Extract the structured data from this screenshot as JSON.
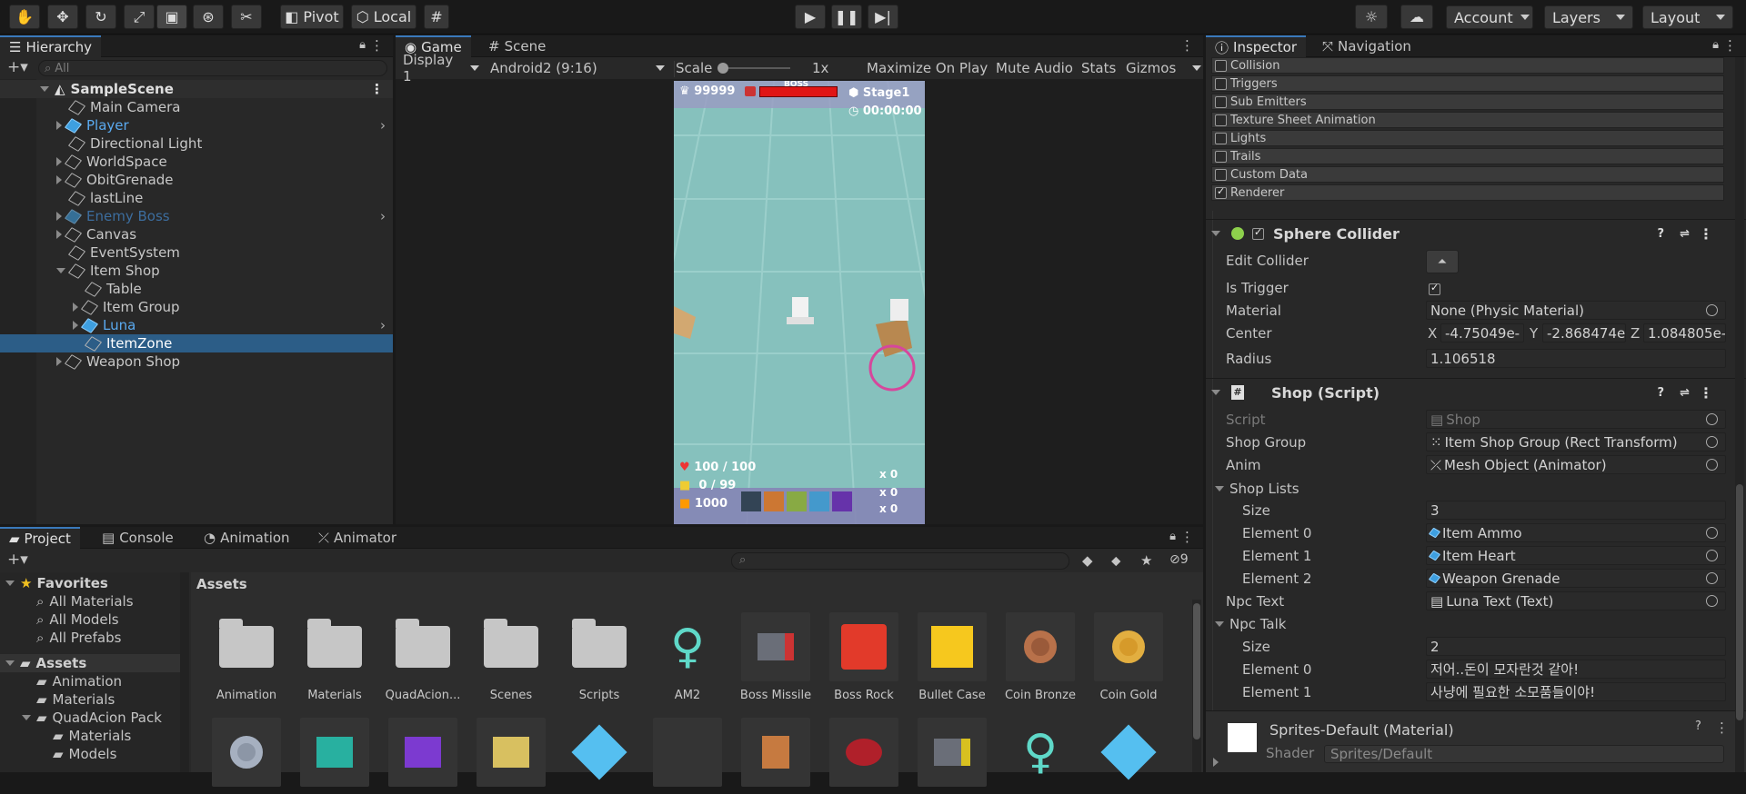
{
  "toolbar": {
    "pivot": "Pivot",
    "local": "Local",
    "account": "Account",
    "layers": "Layers",
    "layout": "Layout"
  },
  "hierarchy": {
    "tab": "Hierarchy",
    "search_placeholder": "All",
    "scene": "SampleScene",
    "items": [
      {
        "label": "Main Camera"
      },
      {
        "label": "Player"
      },
      {
        "label": "Directional Light"
      },
      {
        "label": "WorldSpace"
      },
      {
        "label": "ObitGrenade"
      },
      {
        "label": "lastLine"
      },
      {
        "label": "Enemy Boss"
      },
      {
        "label": "Canvas"
      },
      {
        "label": "EventSystem"
      },
      {
        "label": "Item Shop"
      },
      {
        "label": "Table"
      },
      {
        "label": "Item Group"
      },
      {
        "label": "Luna"
      },
      {
        "label": "ItemZone"
      },
      {
        "label": "Weapon Shop"
      }
    ]
  },
  "game": {
    "tab_game": "Game",
    "tab_scene": "Scene",
    "display": "Display 1",
    "aspect": "Android2 (9:16)",
    "scale_label": "Scale",
    "scale_value": "1x",
    "maximize": "Maximize On Play",
    "mute": "Mute Audio",
    "stats": "Stats",
    "gizmos": "Gizmos",
    "hud": {
      "score": "99999",
      "boss": "BOSS",
      "stage": "Stage1",
      "time": "00:00:00",
      "hp": "100 / 100",
      "bag": "0 / 99",
      "coins": "1000",
      "c1": "x 0",
      "c2": "x 0",
      "c3": "x 0"
    }
  },
  "project": {
    "tabs": {
      "project": "Project",
      "console": "Console",
      "animation": "Animation",
      "animator": "Animator"
    },
    "count": "9",
    "favorites": "Favorites",
    "fav_items": [
      "All Materials",
      "All Models",
      "All Prefabs"
    ],
    "assets_root": "Assets",
    "tree": [
      "Animation",
      "Materials",
      "QuadAcion Pack",
      "Materials",
      "Models"
    ],
    "breadcrumb": "Assets",
    "assets": [
      "Animation",
      "Materials",
      "QuadAcion...",
      "Scenes",
      "Scripts",
      "AM2",
      "Boss Missile",
      "Boss Rock",
      "Bullet Case",
      "Coin Bronze",
      "Coin Gold"
    ]
  },
  "inspector": {
    "tab": "Inspector",
    "tab2": "Navigation",
    "modules": [
      {
        "label": "Collision",
        "checked": false
      },
      {
        "label": "Triggers",
        "checked": false
      },
      {
        "label": "Sub Emitters",
        "checked": false
      },
      {
        "label": "Texture Sheet Animation",
        "checked": false
      },
      {
        "label": "Lights",
        "checked": false
      },
      {
        "label": "Trails",
        "checked": false
      },
      {
        "label": "Custom Data",
        "checked": false
      },
      {
        "label": "Renderer",
        "checked": true
      }
    ],
    "sphere": {
      "title": "Sphere Collider",
      "edit": "Edit Collider",
      "is_trigger": "Is Trigger",
      "material": "Material",
      "material_val": "None (Physic Material)",
      "center": "Center",
      "cx": "-4.75049e-",
      "cy": "-2.868474e",
      "cz": "1.084805e-",
      "radius": "Radius",
      "radius_val": "1.106518"
    },
    "shop": {
      "title": "Shop (Script)",
      "script": "Script",
      "script_val": "Shop",
      "group": "Shop Group",
      "group_val": "Item Shop Group (Rect Transform)",
      "anim": "Anim",
      "anim_val": "Mesh Object (Animator)",
      "lists": "Shop Lists",
      "size": "Size",
      "lists_size": "3",
      "e0": "Element 0",
      "e0v": "Item Ammo",
      "e1": "Element 1",
      "e1v": "Item Heart",
      "e2": "Element 2",
      "e2v": "Weapon Grenade",
      "npc_text": "Npc Text",
      "npc_text_val": "Luna Text (Text)",
      "npc_talk": "Npc Talk",
      "talk_size": "2",
      "t0": "저어..돈이 모자란것 같아!",
      "t1": "사냥에 필요한 소모품들이야!"
    },
    "material": {
      "title": "Sprites-Default (Material)",
      "shader": "Shader",
      "shader_val": "Sprites/Default"
    }
  }
}
